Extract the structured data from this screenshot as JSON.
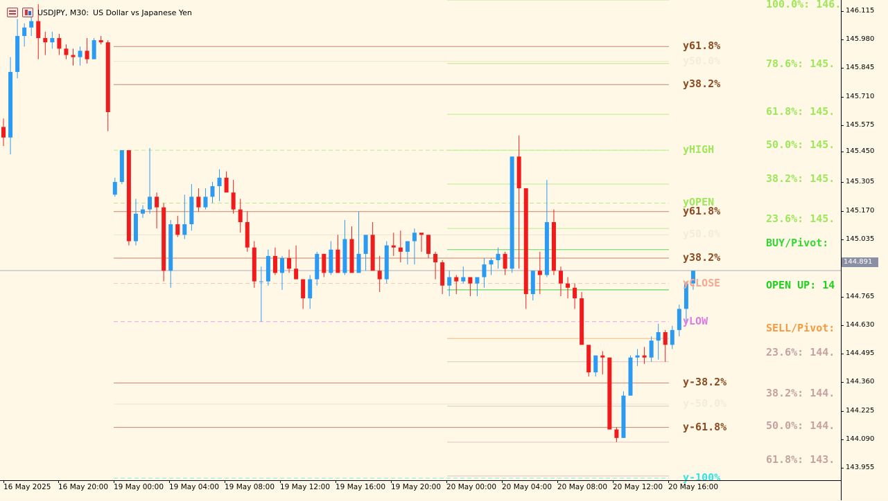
{
  "header": {
    "symbol": "USDJPY, M30:",
    "description": "US Dollar vs Japanese Yen"
  },
  "current_price": "144.891",
  "price_axis": [
    "146.115",
    "145.980",
    "145.845",
    "145.710",
    "145.575",
    "145.450",
    "145.305",
    "145.170",
    "145.035",
    "144.765",
    "144.630",
    "144.495",
    "144.360",
    "144.225",
    "144.090",
    "143.955"
  ],
  "time_axis": [
    "16 May 2025",
    "16 May 20:00",
    "19 May 00:00",
    "19 May 04:00",
    "19 May 08:00",
    "19 May 12:00",
    "19 May 16:00",
    "19 May 20:00",
    "20 May 00:00",
    "20 May 04:00",
    "20 May 08:00",
    "20 May 12:00",
    "20 May 16:00"
  ],
  "levels_left": [
    {
      "label": "y61.8%",
      "color": "#8b4a1f",
      "price": 145.95
    },
    {
      "label": "y50.0%",
      "color": "#f4ecd8",
      "price": 145.88
    },
    {
      "label": "y38.2%",
      "color": "#8b4a1f",
      "price": 145.77
    },
    {
      "label": "yHIGH",
      "color": "#9ee65a",
      "price": 145.46
    },
    {
      "label": "yOPEN",
      "color": "#9ee65a",
      "price": 145.21
    },
    {
      "label": "y61.8%",
      "color": "#8b4a1f",
      "price": 145.17
    },
    {
      "label": "y50.0%",
      "color": "#f4ecd8",
      "price": 145.06
    },
    {
      "label": "y38.2%",
      "color": "#8b4a1f",
      "price": 144.95
    },
    {
      "label": "yCLOSE",
      "color": "#f5a88e",
      "price": 144.83
    },
    {
      "label": "yLOW",
      "color": "#dd7ae0",
      "price": 144.65
    },
    {
      "label": "y-38.2%",
      "color": "#8b4a1f",
      "price": 144.36
    },
    {
      "label": "y-50.0%",
      "color": "#f4ecd8",
      "price": 144.26
    },
    {
      "label": "y-61.8%",
      "color": "#8b4a1f",
      "price": 144.15
    },
    {
      "label": "y-100%",
      "color": "#33e3e3",
      "price": 143.91
    }
  ],
  "levels_right": [
    {
      "label": "100.0%: 146.",
      "color": "#9ee65a"
    },
    {
      "label": "78.6%: 145.",
      "color": "#9ee65a"
    },
    {
      "label": "61.8%: 145.",
      "color": "#9ee65a"
    },
    {
      "label": "50.0%: 145.",
      "color": "#9ee65a"
    },
    {
      "label": "38.2%: 145.",
      "color": "#9ee65a"
    },
    {
      "label": "23.6%: 145.",
      "color": "#9ee65a"
    },
    {
      "label": "BUY/Pivot:",
      "color": "#33d833"
    },
    {
      "label": "OPEN UP: 14",
      "color": "#1fd11f"
    },
    {
      "label": "SELL/Pivot:",
      "color": "#f79a3e"
    },
    {
      "label": "23.6%: 144.",
      "color": "#c4a2a2"
    },
    {
      "label": "38.2%: 144.",
      "color": "#c4a2a2"
    },
    {
      "label": "50.0%: 144.",
      "color": "#c4a2a2"
    },
    {
      "label": "61.8%: 143.",
      "color": "#c4a2a2"
    }
  ],
  "colors": {
    "bull": "#2b9af3",
    "bear": "#ee1c1c",
    "background": "#fff8e7"
  },
  "chart_data": {
    "type": "candlestick",
    "symbol": "USDJPY",
    "timeframe": "M30",
    "candles": [
      [
        145.57,
        145.61,
        145.48,
        145.52
      ],
      [
        145.52,
        145.9,
        145.44,
        145.83
      ],
      [
        145.83,
        146.08,
        145.8,
        146.0
      ],
      [
        146.0,
        146.06,
        145.95,
        146.04
      ],
      [
        146.04,
        146.09,
        146.0,
        146.07
      ],
      [
        146.07,
        146.15,
        145.89,
        145.99
      ],
      [
        145.99,
        146.02,
        145.91,
        145.97
      ],
      [
        145.97,
        146.02,
        145.94,
        145.99
      ],
      [
        145.99,
        146.01,
        145.91,
        145.94
      ],
      [
        145.94,
        145.96,
        145.89,
        145.91
      ],
      [
        145.91,
        145.94,
        145.86,
        145.9
      ],
      [
        145.9,
        145.95,
        145.86,
        145.93
      ],
      [
        145.93,
        145.99,
        145.87,
        145.89
      ],
      [
        145.89,
        145.99,
        145.89,
        145.98
      ],
      [
        145.98,
        146.0,
        145.96,
        145.97
      ],
      [
        145.97,
        145.98,
        145.55,
        145.64
      ],
      [
        145.25,
        145.33,
        145.24,
        145.31
      ],
      [
        145.31,
        145.46,
        145.3,
        145.46
      ],
      [
        145.46,
        145.45,
        145.01,
        145.03
      ],
      [
        145.03,
        145.23,
        145.01,
        145.16
      ],
      [
        145.16,
        145.2,
        145.14,
        145.18
      ],
      [
        145.18,
        145.47,
        145.16,
        145.24
      ],
      [
        145.24,
        145.26,
        145.09,
        145.19
      ],
      [
        145.19,
        145.21,
        144.84,
        144.89
      ],
      [
        144.89,
        145.13,
        144.81,
        145.11
      ],
      [
        145.11,
        145.15,
        145.05,
        145.06
      ],
      [
        145.06,
        145.25,
        145.04,
        145.11
      ],
      [
        145.11,
        145.3,
        145.08,
        145.24
      ],
      [
        145.24,
        145.28,
        145.17,
        145.19
      ],
      [
        145.19,
        145.28,
        145.18,
        145.24
      ],
      [
        145.24,
        145.31,
        145.21,
        145.29
      ],
      [
        145.29,
        145.37,
        145.22,
        145.33
      ],
      [
        145.33,
        145.36,
        145.27,
        145.26
      ],
      [
        145.26,
        145.32,
        145.16,
        145.18
      ],
      [
        145.18,
        145.23,
        145.07,
        145.12
      ],
      [
        145.12,
        145.17,
        144.98,
        145.0
      ],
      [
        145.0,
        145.03,
        144.81,
        144.84
      ],
      [
        144.84,
        144.91,
        144.65,
        144.84
      ],
      [
        144.84,
        144.99,
        144.82,
        144.96
      ],
      [
        144.96,
        145.0,
        144.87,
        144.88
      ],
      [
        144.88,
        144.96,
        144.8,
        144.95
      ],
      [
        144.95,
        144.99,
        144.88,
        144.9
      ],
      [
        144.9,
        145.01,
        144.85,
        144.85
      ],
      [
        144.85,
        144.85,
        144.71,
        144.76
      ],
      [
        144.76,
        144.87,
        144.71,
        144.85
      ],
      [
        144.85,
        144.98,
        144.82,
        144.97
      ],
      [
        144.97,
        144.97,
        144.86,
        144.88
      ],
      [
        144.88,
        145.03,
        144.87,
        144.99
      ],
      [
        144.99,
        145.06,
        144.9,
        144.88
      ],
      [
        144.88,
        145.13,
        144.87,
        145.04
      ],
      [
        145.04,
        145.1,
        144.91,
        144.88
      ],
      [
        144.88,
        145.17,
        144.88,
        144.97
      ],
      [
        144.97,
        145.05,
        144.89,
        145.06
      ],
      [
        145.06,
        145.12,
        144.92,
        144.89
      ],
      [
        144.89,
        144.96,
        144.79,
        144.85
      ],
      [
        144.85,
        145.03,
        144.83,
        145.01
      ],
      [
        145.01,
        145.07,
        144.96,
        145.0
      ],
      [
        145.0,
        145.08,
        144.93,
        144.98
      ],
      [
        144.98,
        145.03,
        144.92,
        145.03
      ],
      [
        145.03,
        145.09,
        144.92,
        145.07
      ],
      [
        145.07,
        145.06,
        144.98,
        145.06
      ],
      [
        145.06,
        145.06,
        144.95,
        144.97
      ],
      [
        144.97,
        144.98,
        144.85,
        144.93
      ],
      [
        144.93,
        144.94,
        144.78,
        144.82
      ],
      [
        144.82,
        144.89,
        144.77,
        144.86
      ],
      [
        144.86,
        144.87,
        144.78,
        144.84
      ],
      [
        144.84,
        144.91,
        144.83,
        144.86
      ],
      [
        144.86,
        144.86,
        144.77,
        144.83
      ],
      [
        144.83,
        144.86,
        144.77,
        144.86
      ],
      [
        144.86,
        144.95,
        144.81,
        144.92
      ],
      [
        144.92,
        144.95,
        144.87,
        144.94
      ],
      [
        144.94,
        145.0,
        144.9,
        144.97
      ],
      [
        144.97,
        144.98,
        144.87,
        144.9
      ],
      [
        144.9,
        145.15,
        144.88,
        145.43
      ],
      [
        145.43,
        145.53,
        144.9,
        145.28
      ],
      [
        145.28,
        145.28,
        144.71,
        144.78
      ],
      [
        144.78,
        144.89,
        144.75,
        144.89
      ],
      [
        144.89,
        144.98,
        144.78,
        144.87
      ],
      [
        144.87,
        145.32,
        144.86,
        145.12
      ],
      [
        145.12,
        145.18,
        144.87,
        144.89
      ],
      [
        144.89,
        144.91,
        144.77,
        144.83
      ],
      [
        144.83,
        144.86,
        144.76,
        144.81
      ],
      [
        144.81,
        144.83,
        144.71,
        144.76
      ],
      [
        144.76,
        144.79,
        144.56,
        144.54
      ],
      [
        144.54,
        144.51,
        144.39,
        144.41
      ],
      [
        144.41,
        144.48,
        144.39,
        144.49
      ],
      [
        144.49,
        144.51,
        144.4,
        144.48
      ],
      [
        144.48,
        144.48,
        144.14,
        144.14
      ],
      [
        144.14,
        144.15,
        144.08,
        144.1
      ],
      [
        144.1,
        144.32,
        144.1,
        144.3
      ],
      [
        144.3,
        144.49,
        144.3,
        144.48
      ],
      [
        144.48,
        144.52,
        144.44,
        144.49
      ],
      [
        144.49,
        144.53,
        144.45,
        144.48
      ],
      [
        144.48,
        144.58,
        144.46,
        144.56
      ],
      [
        144.56,
        144.64,
        144.47,
        144.6
      ],
      [
        144.6,
        144.61,
        144.46,
        144.54
      ],
      [
        144.54,
        144.63,
        144.52,
        144.61
      ],
      [
        144.61,
        144.73,
        144.58,
        144.71
      ],
      [
        144.71,
        144.84,
        144.65,
        144.83
      ],
      [
        144.83,
        144.89,
        144.8,
        144.89
      ]
    ],
    "ylim": [
      143.9,
      146.17
    ],
    "x_ticks": [
      "16 May 2025",
      "16 May 20:00",
      "19 May 00:00",
      "19 May 04:00",
      "19 May 08:00",
      "19 May 12:00",
      "19 May 16:00",
      "19 May 20:00",
      "20 May 00:00",
      "20 May 04:00",
      "20 May 08:00",
      "20 May 12:00",
      "20 May 16:00"
    ],
    "title": "USDJPY, M30: US Dollar vs Japanese Yen"
  }
}
